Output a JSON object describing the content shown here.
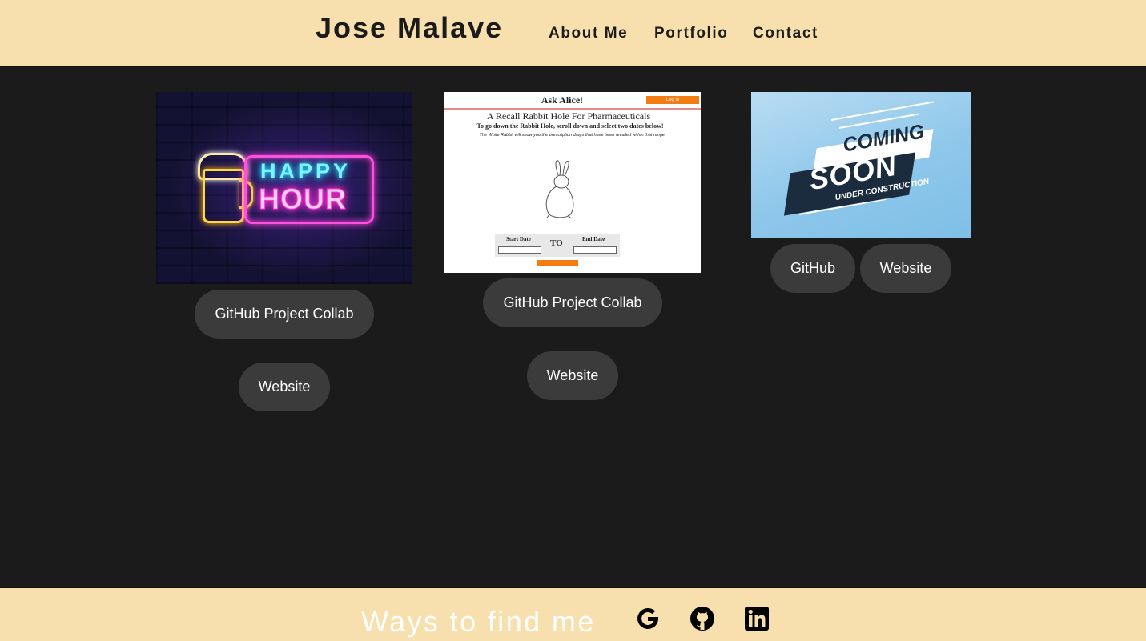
{
  "header": {
    "brand": "Jose Malave",
    "nav": [
      "About Me",
      "Portfolio",
      "Contact"
    ]
  },
  "projects": [
    {
      "image": {
        "sign_top": "HAPPY",
        "sign_bottom": "HOUR"
      },
      "buttons": [
        "GitHub Project Collab",
        "Website"
      ]
    },
    {
      "image": {
        "title": "Ask Alice!",
        "login": "Log in",
        "heading": "A Recall Rabbit Hole For Pharmaceuticals",
        "instruction": "To go down the Rabbit Hole, scroll down and select two dates below!",
        "note": "The White Rabbit will show you the prescription drugs that have been recalled within that range.",
        "start_label": "Start Date",
        "to_label": "TO",
        "end_label": "End Date"
      },
      "buttons": [
        "GitHub Project Collab",
        "Website"
      ]
    },
    {
      "image": {
        "line1": "COMING",
        "line2": "SOON",
        "line3": "UNDER CONSTRUCTION"
      },
      "buttons": [
        "GitHub",
        "Website"
      ]
    }
  ],
  "footer": {
    "title": "Ways to find me",
    "icons": [
      "google-icon",
      "github-icon",
      "linkedin-icon"
    ]
  },
  "colors": {
    "header_bg": "#f7e0ad",
    "page_bg": "#1b1b1b",
    "button_bg": "#3b3b3b",
    "button_text": "#ffffff"
  }
}
